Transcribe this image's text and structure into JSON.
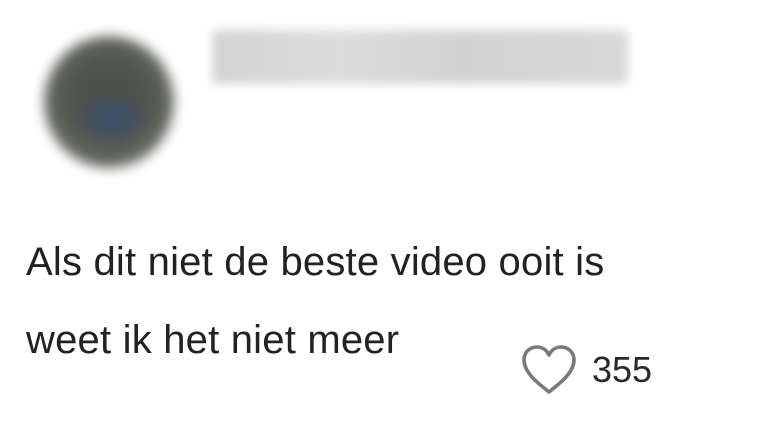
{
  "comment": {
    "text_line_1": "Als dit niet de beste video ooit is",
    "text_line_2": "weet ik het niet meer",
    "likes": "355",
    "like_icon": "heart-outline-icon"
  }
}
